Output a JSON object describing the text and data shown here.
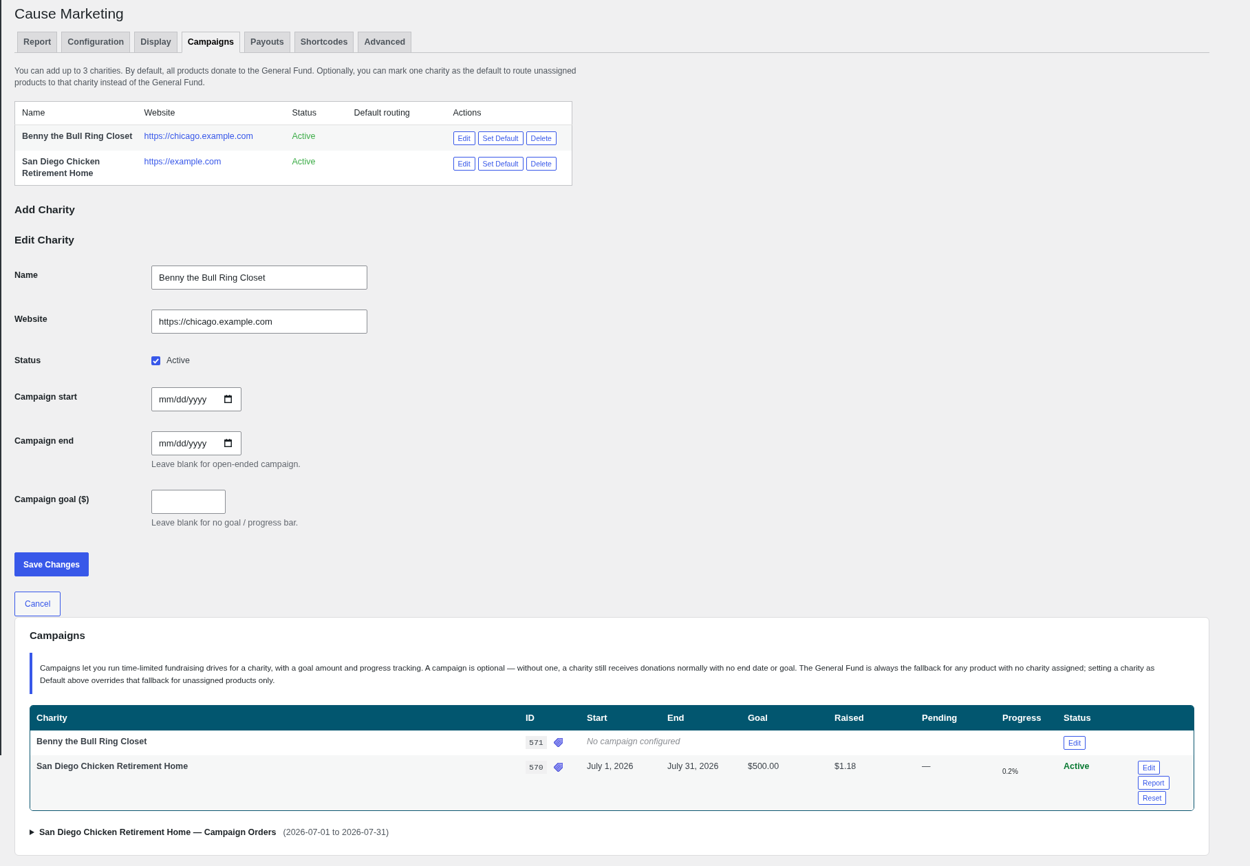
{
  "page": {
    "title": "Cause Marketing"
  },
  "tabs": [
    {
      "label": "Report",
      "selected": false
    },
    {
      "label": "Configuration",
      "selected": false
    },
    {
      "label": "Display",
      "selected": false
    },
    {
      "label": "Campaigns",
      "selected": true
    },
    {
      "label": "Payouts",
      "selected": false
    },
    {
      "label": "Shortcodes",
      "selected": false
    },
    {
      "label": "Advanced",
      "selected": false
    }
  ],
  "intro": "You can add up to 3 charities. By default, all products donate to the General Fund. Optionally, you can mark one charity as the default to route unassigned products to that charity instead of the General Fund.",
  "charities_table": {
    "columns": [
      "Name",
      "Website",
      "Status",
      "Default routing",
      "Actions"
    ],
    "rows": [
      {
        "name": "Benny the Bull Ring Closet",
        "website": "https://chicago.example.com",
        "status": "Active",
        "actions": [
          "Edit",
          "Set Default",
          "Delete"
        ]
      },
      {
        "name": "San Diego Chicken Retirement Home",
        "website": "https://example.com",
        "status": "Active",
        "actions": [
          "Edit",
          "Set Default",
          "Delete"
        ]
      }
    ]
  },
  "add_charity": {
    "heading": "Add Charity"
  },
  "edit_charity": {
    "heading": "Edit Charity",
    "fields": [
      {
        "kind": "text",
        "label": "Name",
        "value": "Benny the Bull Ring Closet"
      },
      {
        "kind": "text",
        "label": "Website",
        "value": "https://chicago.example.com"
      },
      {
        "kind": "checkbox",
        "label": "Status",
        "option": "Active",
        "checked": true
      },
      {
        "kind": "date",
        "label": "Campaign start",
        "placeholder": "mm/dd/yyyy"
      },
      {
        "kind": "date",
        "label": "Campaign end",
        "placeholder": "mm/dd/yyyy",
        "help": "Leave blank for open-ended campaign."
      },
      {
        "kind": "number",
        "label": "Campaign goal ($)",
        "help": "Leave blank for no goal / progress bar."
      }
    ],
    "buttons": [
      {
        "kind": "save",
        "label": "Save Changes"
      },
      {
        "kind": "cancel",
        "label": "Cancel"
      }
    ]
  },
  "campaigns": {
    "title": "Campaigns",
    "notice": "Campaigns let you run time-limited fundraising drives for a charity, with a goal amount and progress tracking. A campaign is optional — without one, a charity still receives donations normally with no end date or goal. The General Fund is always the fallback for any product with no charity assigned; setting a charity as Default above overrides that fallback for unassigned products only.",
    "table": {
      "columns": [
        "Charity",
        "ID",
        "Start",
        "End",
        "Goal",
        "Raised",
        "Pending",
        "Progress",
        "Status"
      ],
      "rows": [
        {
          "kind": "empty",
          "charity": "Benny the Bull Ring Closet",
          "id": "571",
          "note": "No campaign configured",
          "actions": [
            "Edit"
          ]
        },
        {
          "kind": "campaign",
          "charity": "San Diego Chicken Retirement Home",
          "id": "570",
          "start": "July 1, 2026",
          "end": "July 31, 2026",
          "goal": "$500.00",
          "raised": "$1.18",
          "pending": "—",
          "progress": "0.2%",
          "status": "Active",
          "actions": [
            "Edit",
            "Report",
            "Reset"
          ]
        }
      ]
    },
    "orders": {
      "expanded": false,
      "title": "San Diego Chicken Retirement Home — Campaign Orders",
      "range": "(2026-07-01 to 2026-07-31)"
    }
  }
}
